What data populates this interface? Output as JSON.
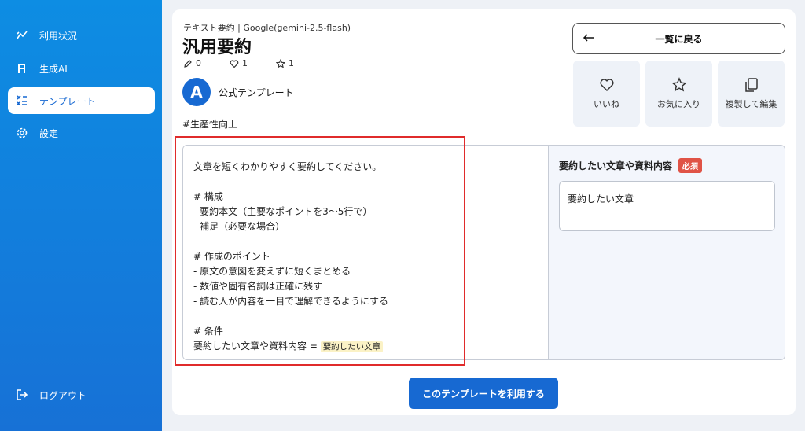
{
  "sidebar": {
    "items": [
      {
        "label": "利用状況",
        "icon": "chart-icon"
      },
      {
        "label": "生成AI",
        "icon": "brand-logo-icon"
      },
      {
        "label": "テンプレート",
        "icon": "template-icon"
      },
      {
        "label": "設定",
        "icon": "gear-icon"
      }
    ],
    "logout_label": "ログアウト"
  },
  "header": {
    "breadcrumb": "テキスト要約 | Google(gemini-2.5-flash)",
    "title": "汎用要約",
    "stats": {
      "edits": "0",
      "likes": "1",
      "favorites": "1"
    },
    "author": "公式テンプレート",
    "logo_letter": "A",
    "tag": "#生産性向上"
  },
  "actions": {
    "back_label": "一覧に戻る",
    "like_label": "いいね",
    "favorite_label": "お気に入り",
    "duplicate_label": "複製して編集"
  },
  "prompt": {
    "text": "文章を短くわかりやすく要約してください。\n\n# 構成\n- 要約本文（主要なポイントを3〜5行で）\n- 補足（必要な場合）\n\n# 作成のポイント\n- 原文の意図を変えずに短くまとめる\n- 数値や固有名詞は正確に残す\n- 読む人が内容を一目で理解できるようにする\n\n# 条件\n要約したい文章や資料内容 = ",
    "variable": "要約したい文章"
  },
  "form": {
    "field_label": "要約したい文章や資料内容",
    "required_label": "必須",
    "field_value": "要約したい文章"
  },
  "submit_label": "このテンプレートを利用する",
  "colors": {
    "accent": "#1769d2",
    "required": "#e05346",
    "highlight": "#fbf2c6",
    "annotation": "#e02b2b"
  }
}
